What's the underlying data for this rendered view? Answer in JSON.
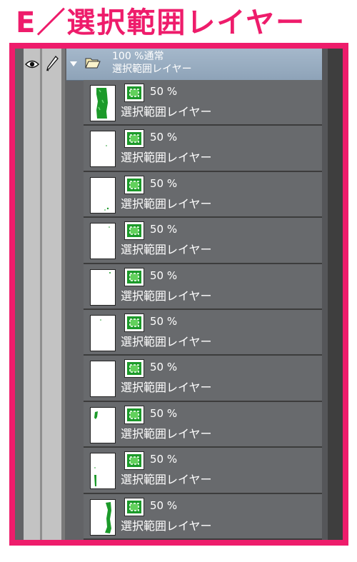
{
  "title": "E／選択範囲レイヤー",
  "header": {
    "eye_icon": "eye-icon",
    "pen_icon": "pen-icon"
  },
  "folder": {
    "opacity_mode": "100 %通常",
    "name": "選択範囲レイヤー",
    "icon": "folder-open-icon"
  },
  "layers": [
    {
      "opacity": "50 %",
      "name": "選択範囲レイヤー"
    },
    {
      "opacity": "50 %",
      "name": "選択範囲レイヤー"
    },
    {
      "opacity": "50 %",
      "name": "選択範囲レイヤー"
    },
    {
      "opacity": "50 %",
      "name": "選択範囲レイヤー"
    },
    {
      "opacity": "50 %",
      "name": "選択範囲レイヤー"
    },
    {
      "opacity": "50 %",
      "name": "選択範囲レイヤー"
    },
    {
      "opacity": "50 %",
      "name": "選択範囲レイヤー"
    },
    {
      "opacity": "50 %",
      "name": "選択範囲レイヤー"
    },
    {
      "opacity": "50 %",
      "name": "選択範囲レイヤー"
    },
    {
      "opacity": "50 %",
      "name": "選択範囲レイヤー"
    }
  ],
  "colors": {
    "accent": "#ee1c6b",
    "selection_green": "#1c9a2a",
    "folder_header": "#9db1c5"
  }
}
